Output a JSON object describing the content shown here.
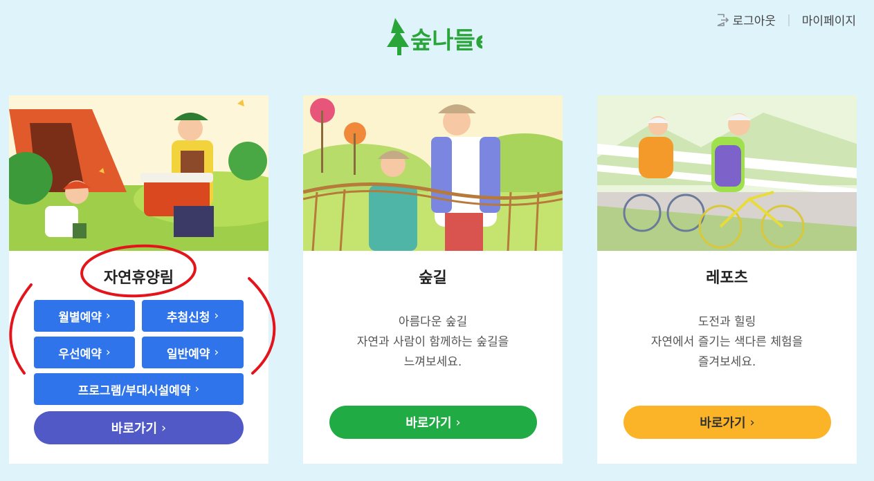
{
  "header": {
    "logo_alt": "숲나들e",
    "logout_label": "로그아웃",
    "separator": "|",
    "mypage_label": "마이페이지"
  },
  "cards": [
    {
      "title": "자연휴양림",
      "buttons": {
        "monthly": "월별예약",
        "lottery": "추첨신청",
        "priority": "우선예약",
        "general": "일반예약",
        "program": "프로그램/부대시설예약"
      },
      "go_label": "바로가기",
      "go_color": "#5159c7"
    },
    {
      "title": "숲길",
      "desc": [
        "아름다운 숲길",
        "자연과 사람이 함께하는 숲길을",
        "느껴보세요."
      ],
      "go_label": "바로가기",
      "go_color": "#21ab45"
    },
    {
      "title": "레포츠",
      "desc": [
        "도전과 힐링",
        "자연에서 즐기는 색다른 체험을",
        "즐겨보세요."
      ],
      "go_label": "바로가기",
      "go_color": "#fbb427"
    }
  ],
  "colors": {
    "page_bg": "#dff3fb",
    "sub_button": "#2f74ea",
    "annotation": "#e3141b"
  },
  "chevron": "›"
}
